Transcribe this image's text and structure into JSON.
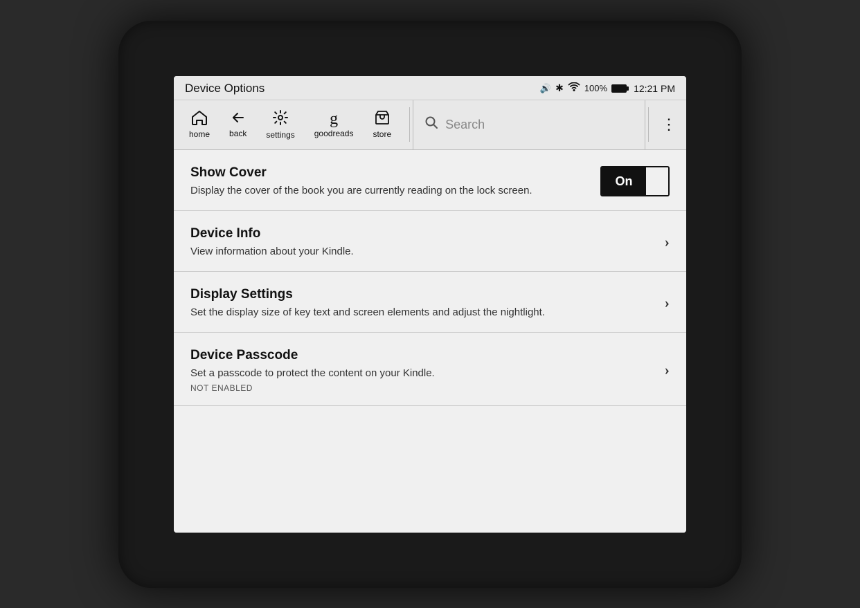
{
  "status_bar": {
    "title": "Device Options",
    "volume_icon": "🔊",
    "bluetooth_icon": "✱",
    "wifi_icon": "📶",
    "battery_percent": "100%",
    "time": "12:21 PM"
  },
  "nav": {
    "home_label": "home",
    "back_label": "back",
    "settings_label": "settings",
    "goodreads_label": "goodreads",
    "store_label": "store",
    "search_placeholder": "Search",
    "more_icon": "⋮"
  },
  "settings": {
    "show_cover": {
      "title": "Show Cover",
      "description": "Display the cover of the book you are currently reading on the lock screen.",
      "toggle_label": "On",
      "enabled": true
    },
    "device_info": {
      "title": "Device Info",
      "description": "View information about your Kindle."
    },
    "display_settings": {
      "title": "Display Settings",
      "description": "Set the display size of key text and screen elements and adjust the nightlight."
    },
    "device_passcode": {
      "title": "Device Passcode",
      "description": "Set a passcode to protect the content on your Kindle.",
      "sub_label": "NOT ENABLED"
    }
  }
}
